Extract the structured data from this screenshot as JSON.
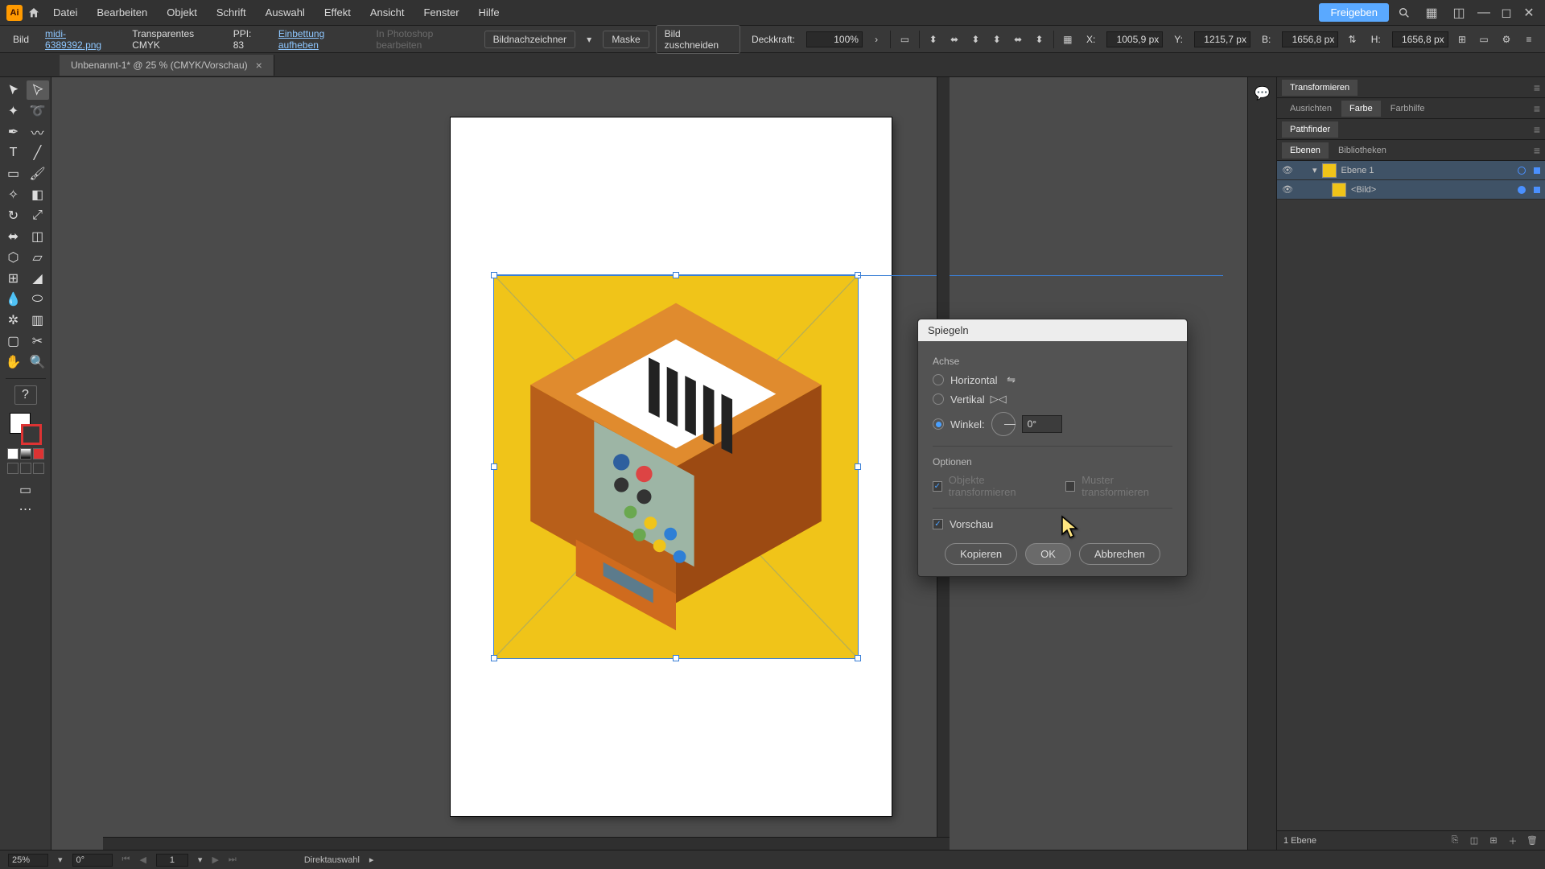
{
  "app": {
    "logo_text": "Ai"
  },
  "menu": {
    "items": [
      "Datei",
      "Bearbeiten",
      "Objekt",
      "Schrift",
      "Auswahl",
      "Effekt",
      "Ansicht",
      "Fenster",
      "Hilfe"
    ],
    "share": "Freigeben"
  },
  "control": {
    "context": "Bild",
    "filename": "midi-6389392.png",
    "colormode": "Transparentes CMYK",
    "ppi_label": "PPI:",
    "ppi_value": "83",
    "unembed": "Einbettung aufheben",
    "edit_in_ps": "In Photoshop bearbeiten",
    "image_trace": "Bildnachzeichner",
    "mask": "Maske",
    "crop": "Bild zuschneiden",
    "opacity_label": "Deckkraft:",
    "opacity_value": "100%",
    "x_label": "X:",
    "x_value": "1005,9 px",
    "y_label": "Y:",
    "y_value": "1215,7 px",
    "w_label": "B:",
    "w_value": "1656,8 px",
    "h_label": "H:",
    "h_value": "1656,8 px"
  },
  "tab": {
    "title": "Unbenannt-1* @ 25 % (CMYK/Vorschau)"
  },
  "panels": {
    "row1": {
      "tabs": [
        "Transformieren"
      ]
    },
    "row2": {
      "tabs": [
        "Ausrichten",
        "Farbe",
        "Farbhilfe"
      ],
      "active": 1
    },
    "row3": {
      "tabs": [
        "Pathfinder"
      ]
    },
    "row4": {
      "tabs": [
        "Ebenen",
        "Bibliotheken"
      ],
      "active": 0
    }
  },
  "layers": {
    "items": [
      {
        "name": "Ebene 1",
        "level": 0,
        "expanded": true,
        "selected": true
      },
      {
        "name": "<Bild>",
        "level": 1,
        "expanded": false,
        "selected": true
      }
    ],
    "footer_count": "1 Ebene"
  },
  "dialog": {
    "title": "Spiegeln",
    "axis_label": "Achse",
    "opt_horizontal": "Horizontal",
    "opt_vertical": "Vertikal",
    "opt_angle": "Winkel:",
    "angle_value": "0°",
    "options_label": "Optionen",
    "opt_transform_objects": "Objekte transformieren",
    "opt_transform_patterns": "Muster transformieren",
    "preview": "Vorschau",
    "btn_copy": "Kopieren",
    "btn_ok": "OK",
    "btn_cancel": "Abbrechen"
  },
  "status": {
    "zoom": "25%",
    "rotation": "0°",
    "artboard": "1",
    "tool": "Direktauswahl"
  }
}
